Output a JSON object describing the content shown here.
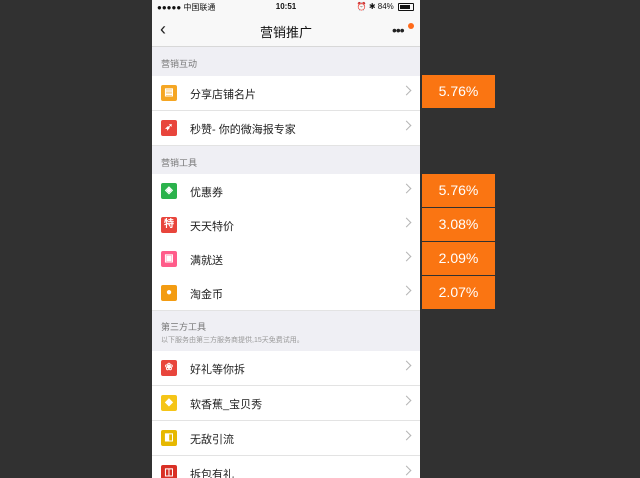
{
  "status_bar": {
    "carrier": "●●●●● 中国联通",
    "time": "10:51",
    "battery": "84%",
    "battery_level": 0.84
  },
  "nav": {
    "back_icon": "chevron-left-icon",
    "title": "营销推广",
    "more_icon": "more-icon",
    "badge_color": "#ff6a1a"
  },
  "sections": [
    {
      "title": "营销互动",
      "items": [
        {
          "label": "分享店铺名片",
          "icon": "card-icon",
          "color": "#f5a623"
        },
        {
          "label": "秒赞- 你的微海报专家",
          "icon": "thumb-icon",
          "color": "#e8453c"
        }
      ]
    },
    {
      "title": "营销工具",
      "items": [
        {
          "label": "优惠券",
          "icon": "coupon-icon",
          "color": "#2bb24c"
        },
        {
          "label": "天天特价",
          "icon": "special-price-icon",
          "glyph": "特",
          "color": "#e8453c"
        },
        {
          "label": "满就送",
          "icon": "gift-icon",
          "color": "#ff5c8a"
        },
        {
          "label": "淘金币",
          "icon": "coin-icon",
          "color": "#f39c12"
        }
      ]
    },
    {
      "title": "第三方工具",
      "subtitle": "以下服务由第三方服务商提供,15天免费试用。",
      "items": [
        {
          "label": "好礼等你拆",
          "icon": "present-icon",
          "color": "#e8453c"
        },
        {
          "label": "软香蕉_宝贝秀",
          "icon": "banana-icon",
          "color": "#f5c518"
        },
        {
          "label": "无敌引流",
          "icon": "traffic-icon",
          "color": "#e6b800"
        },
        {
          "label": "拆包有礼",
          "icon": "package-icon",
          "color": "#d93025"
        }
      ]
    }
  ],
  "percent_tags": [
    "5.76%",
    "5.76%",
    "3.08%",
    "2.09%",
    "2.07%"
  ],
  "accent_color": "#fa7512"
}
